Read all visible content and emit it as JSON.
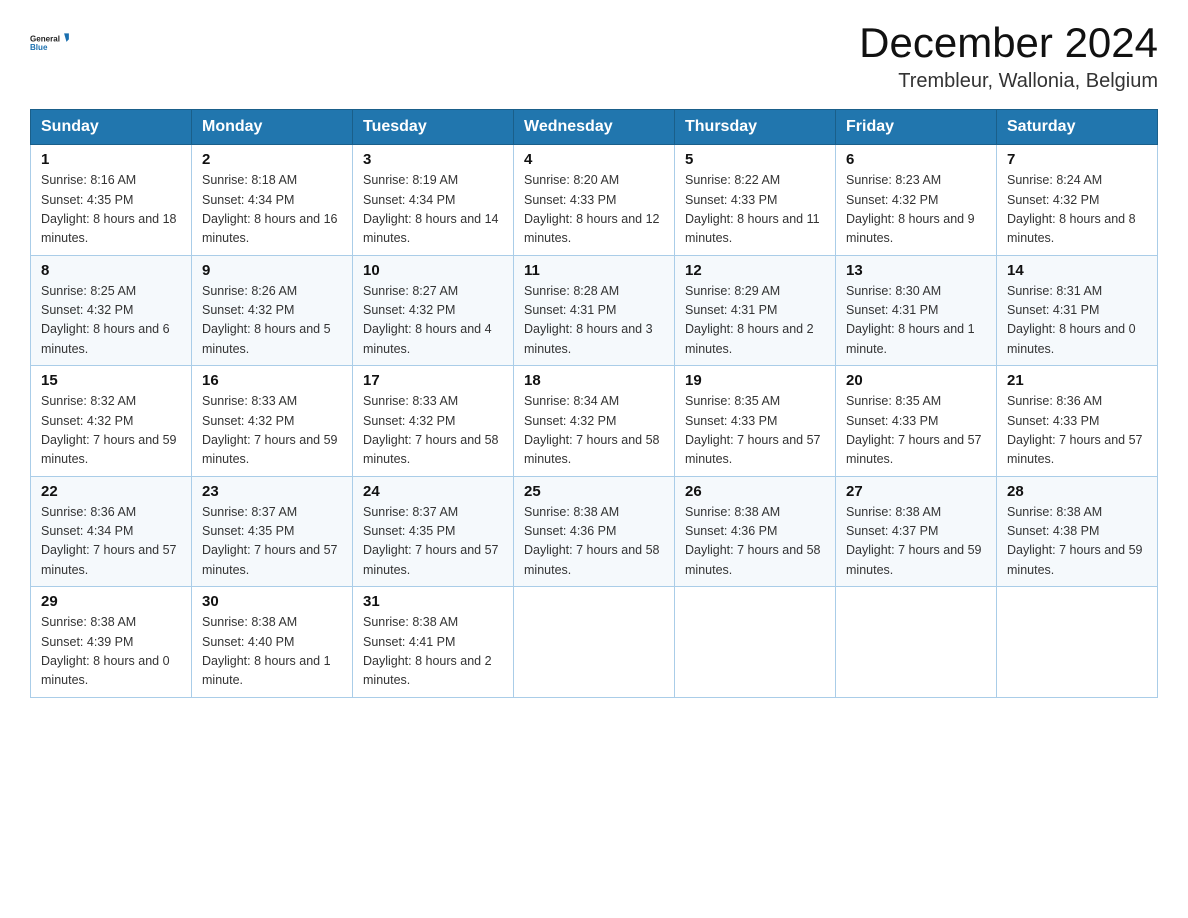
{
  "header": {
    "month_year": "December 2024",
    "location": "Trembleur, Wallonia, Belgium",
    "logo_general": "General",
    "logo_blue": "Blue"
  },
  "days_of_week": [
    "Sunday",
    "Monday",
    "Tuesday",
    "Wednesday",
    "Thursday",
    "Friday",
    "Saturday"
  ],
  "weeks": [
    [
      {
        "day": "1",
        "sunrise": "8:16 AM",
        "sunset": "4:35 PM",
        "daylight": "8 hours and 18 minutes."
      },
      {
        "day": "2",
        "sunrise": "8:18 AM",
        "sunset": "4:34 PM",
        "daylight": "8 hours and 16 minutes."
      },
      {
        "day": "3",
        "sunrise": "8:19 AM",
        "sunset": "4:34 PM",
        "daylight": "8 hours and 14 minutes."
      },
      {
        "day": "4",
        "sunrise": "8:20 AM",
        "sunset": "4:33 PM",
        "daylight": "8 hours and 12 minutes."
      },
      {
        "day": "5",
        "sunrise": "8:22 AM",
        "sunset": "4:33 PM",
        "daylight": "8 hours and 11 minutes."
      },
      {
        "day": "6",
        "sunrise": "8:23 AM",
        "sunset": "4:32 PM",
        "daylight": "8 hours and 9 minutes."
      },
      {
        "day": "7",
        "sunrise": "8:24 AM",
        "sunset": "4:32 PM",
        "daylight": "8 hours and 8 minutes."
      }
    ],
    [
      {
        "day": "8",
        "sunrise": "8:25 AM",
        "sunset": "4:32 PM",
        "daylight": "8 hours and 6 minutes."
      },
      {
        "day": "9",
        "sunrise": "8:26 AM",
        "sunset": "4:32 PM",
        "daylight": "8 hours and 5 minutes."
      },
      {
        "day": "10",
        "sunrise": "8:27 AM",
        "sunset": "4:32 PM",
        "daylight": "8 hours and 4 minutes."
      },
      {
        "day": "11",
        "sunrise": "8:28 AM",
        "sunset": "4:31 PM",
        "daylight": "8 hours and 3 minutes."
      },
      {
        "day": "12",
        "sunrise": "8:29 AM",
        "sunset": "4:31 PM",
        "daylight": "8 hours and 2 minutes."
      },
      {
        "day": "13",
        "sunrise": "8:30 AM",
        "sunset": "4:31 PM",
        "daylight": "8 hours and 1 minute."
      },
      {
        "day": "14",
        "sunrise": "8:31 AM",
        "sunset": "4:31 PM",
        "daylight": "8 hours and 0 minutes."
      }
    ],
    [
      {
        "day": "15",
        "sunrise": "8:32 AM",
        "sunset": "4:32 PM",
        "daylight": "7 hours and 59 minutes."
      },
      {
        "day": "16",
        "sunrise": "8:33 AM",
        "sunset": "4:32 PM",
        "daylight": "7 hours and 59 minutes."
      },
      {
        "day": "17",
        "sunrise": "8:33 AM",
        "sunset": "4:32 PM",
        "daylight": "7 hours and 58 minutes."
      },
      {
        "day": "18",
        "sunrise": "8:34 AM",
        "sunset": "4:32 PM",
        "daylight": "7 hours and 58 minutes."
      },
      {
        "day": "19",
        "sunrise": "8:35 AM",
        "sunset": "4:33 PM",
        "daylight": "7 hours and 57 minutes."
      },
      {
        "day": "20",
        "sunrise": "8:35 AM",
        "sunset": "4:33 PM",
        "daylight": "7 hours and 57 minutes."
      },
      {
        "day": "21",
        "sunrise": "8:36 AM",
        "sunset": "4:33 PM",
        "daylight": "7 hours and 57 minutes."
      }
    ],
    [
      {
        "day": "22",
        "sunrise": "8:36 AM",
        "sunset": "4:34 PM",
        "daylight": "7 hours and 57 minutes."
      },
      {
        "day": "23",
        "sunrise": "8:37 AM",
        "sunset": "4:35 PM",
        "daylight": "7 hours and 57 minutes."
      },
      {
        "day": "24",
        "sunrise": "8:37 AM",
        "sunset": "4:35 PM",
        "daylight": "7 hours and 57 minutes."
      },
      {
        "day": "25",
        "sunrise": "8:38 AM",
        "sunset": "4:36 PM",
        "daylight": "7 hours and 58 minutes."
      },
      {
        "day": "26",
        "sunrise": "8:38 AM",
        "sunset": "4:36 PM",
        "daylight": "7 hours and 58 minutes."
      },
      {
        "day": "27",
        "sunrise": "8:38 AM",
        "sunset": "4:37 PM",
        "daylight": "7 hours and 59 minutes."
      },
      {
        "day": "28",
        "sunrise": "8:38 AM",
        "sunset": "4:38 PM",
        "daylight": "7 hours and 59 minutes."
      }
    ],
    [
      {
        "day": "29",
        "sunrise": "8:38 AM",
        "sunset": "4:39 PM",
        "daylight": "8 hours and 0 minutes."
      },
      {
        "day": "30",
        "sunrise": "8:38 AM",
        "sunset": "4:40 PM",
        "daylight": "8 hours and 1 minute."
      },
      {
        "day": "31",
        "sunrise": "8:38 AM",
        "sunset": "4:41 PM",
        "daylight": "8 hours and 2 minutes."
      },
      null,
      null,
      null,
      null
    ]
  ]
}
